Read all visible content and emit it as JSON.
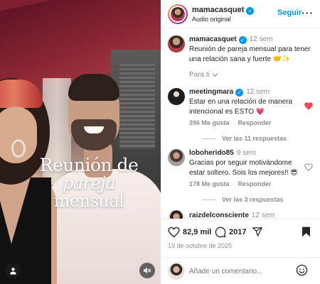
{
  "video": {
    "overlay_line1": "Reunión de",
    "overlay_line2_italic": "pareja",
    "overlay_line2_rest": " mensual",
    "user_icon": "user-icon",
    "mute_icon": "speaker-muted-icon"
  },
  "header": {
    "username": "mamacasquet",
    "audio": "Audio original",
    "follow_label": "Seguir",
    "more_label": "···"
  },
  "caption": {
    "username": "mamacasquet",
    "time": "12 sem",
    "text": "Reunión de pareja mensual para tener una relación sana y fuerte 🤝✨"
  },
  "filter": {
    "label": "Para ti",
    "icon": "chevron-down-icon"
  },
  "comments": [
    {
      "username": "meetingmara",
      "verified": true,
      "time": "12 sem",
      "text": "Estar en una relación de manera intencional es ESTO 💗",
      "likes": "396 Me gusta",
      "reply_label": "Responder",
      "replies": "Ver las 11 respuestas",
      "liked": true
    },
    {
      "username": "loboherido85",
      "verified": false,
      "time": "9 sem",
      "text": "Gracias por seguir motivándome estar soltero. Sois los mejores!! 😎",
      "likes": "178 Me gusta",
      "reply_label": "Responder",
      "replies": "Ver las 3 respuestas",
      "liked": false
    },
    {
      "username": "raizdelconsciente",
      "verified": false,
      "time": "12 sem"
    }
  ],
  "actions": {
    "likes": "82,9 mil",
    "comments": "2017",
    "date": "19 de octubre de 2025"
  },
  "add_comment": {
    "placeholder": "Añade un comentario..."
  },
  "colors": {
    "link": "#0095f6",
    "liked_heart": "#ed4956",
    "muted_text": "#8e8e8e"
  }
}
